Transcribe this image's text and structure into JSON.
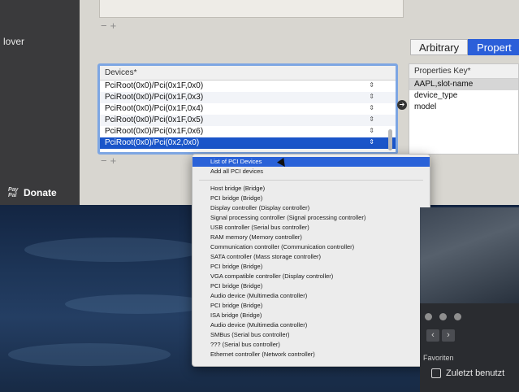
{
  "sidebar": {
    "label": "lover",
    "donate_label": "Donate",
    "paypal_mark": "Pay Pal"
  },
  "tabs": [
    {
      "label": "Arbitrary",
      "active": false
    },
    {
      "label": "Propert",
      "active": true
    }
  ],
  "devices": {
    "header": "Devices*",
    "rows": [
      "PciRoot(0x0)/Pci(0x1F,0x0)",
      "PciRoot(0x0)/Pci(0x1F,0x3)",
      "PciRoot(0x0)/Pci(0x1F,0x4)",
      "PciRoot(0x0)/Pci(0x1F,0x5)",
      "PciRoot(0x0)/Pci(0x1F,0x6)",
      "PciRoot(0x0)/Pci(0x2,0x0)"
    ],
    "selected_index": 5
  },
  "properties": {
    "header": "Properties Key*",
    "rows": [
      "AAPL,slot-name",
      "device_type",
      "model"
    ]
  },
  "popup_menu": {
    "top_items": [
      "List of PCI Devices",
      "Add all PCI devices"
    ],
    "highlighted_index": 0,
    "items": [
      "Host bridge (Bridge)",
      "PCI bridge (Bridge)",
      "Display controller (Display controller)",
      "Signal processing controller (Signal processing controller)",
      "USB controller (Serial bus controller)",
      "RAM memory (Memory controller)",
      "Communication controller (Communication controller)",
      "SATA controller (Mass storage controller)",
      "PCI bridge (Bridge)",
      "VGA compatible controller (Display controller)",
      "PCI bridge (Bridge)",
      "Audio device (Multimedia controller)",
      "PCI bridge (Bridge)",
      "ISA bridge (Bridge)",
      "Audio device (Multimedia controller)",
      "SMBus (Serial bus controller)",
      "??? (Serial bus controller)",
      "Ethernet controller (Network controller)"
    ]
  },
  "finder": {
    "favorites_label": "Favoriten",
    "recent_label": "Zuletzt benutzt"
  },
  "icons": {
    "stepper": "⇕",
    "arrow": "➔",
    "minus_plus": "−+"
  }
}
